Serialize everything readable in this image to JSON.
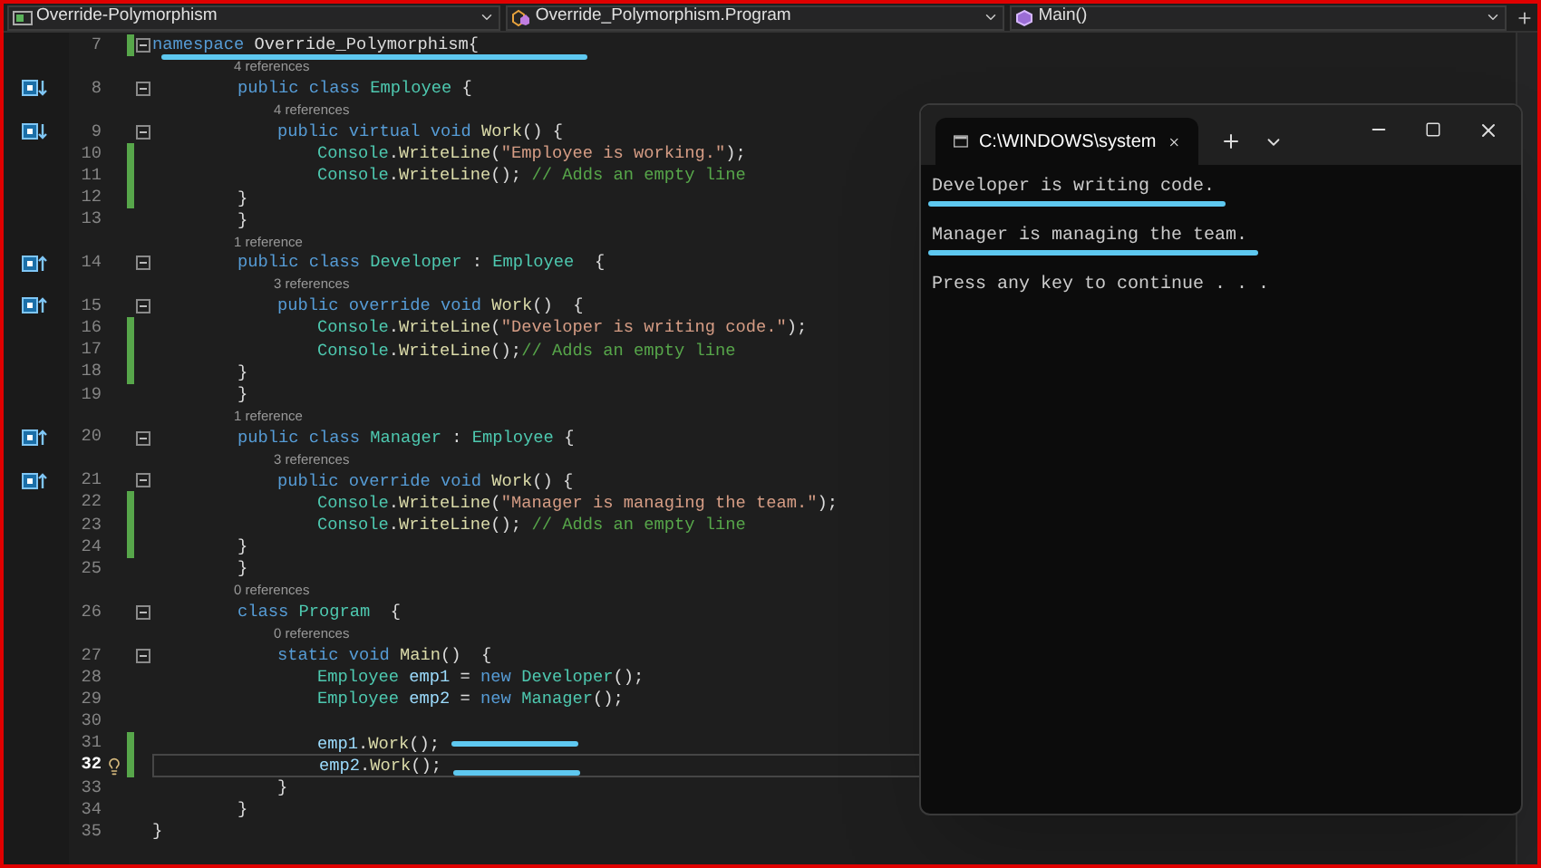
{
  "navigation_bar": {
    "project": "Override-Polymorphism",
    "type": "Override_Polymorphism.Program",
    "member": "Main()"
  },
  "editor": {
    "lines": [
      {
        "number": "7",
        "modified": true,
        "foldable": true,
        "current": false,
        "marked": true,
        "tokens": [
          {
            "kind": "kw",
            "text": "namespace "
          },
          {
            "kind": "plain",
            "text": "Override_Polymorphism{"
          }
        ],
        "children": [
          {
            "number": "8",
            "lens": "4 references",
            "gutter": {
              "kind": "overridden"
            },
            "modified": false,
            "foldable": true,
            "current": false,
            "marked": false,
            "tokens": [
              {
                "kind": "kw",
                "text": "public class "
              },
              {
                "kind": "type",
                "text": "Employee"
              },
              {
                "kind": "plain",
                "text": " {"
              }
            ],
            "children": [
              {
                "number": "9",
                "lens": "4 references",
                "gutter": {
                  "kind": "overridden"
                },
                "modified": false,
                "foldable": true,
                "current": false,
                "marked": false,
                "tokens": [
                  {
                    "kind": "kw",
                    "text": "public virtual void "
                  },
                  {
                    "kind": "method",
                    "text": "Work"
                  },
                  {
                    "kind": "plain",
                    "text": "() {"
                  }
                ],
                "children": [
                  {
                    "number": "10",
                    "modified": true,
                    "foldable": false,
                    "current": false,
                    "marked": false,
                    "tokens": [
                      {
                        "kind": "type",
                        "text": "Console"
                      },
                      {
                        "kind": "plain",
                        "text": "."
                      },
                      {
                        "kind": "method",
                        "text": "WriteLine"
                      },
                      {
                        "kind": "plain",
                        "text": "("
                      },
                      {
                        "kind": "str",
                        "text": "\"Employee is working.\""
                      },
                      {
                        "kind": "plain",
                        "text": ");"
                      }
                    ]
                  },
                  {
                    "number": "11",
                    "modified": true,
                    "foldable": false,
                    "current": false,
                    "marked": false,
                    "tokens": [
                      {
                        "kind": "type",
                        "text": "Console"
                      },
                      {
                        "kind": "plain",
                        "text": "."
                      },
                      {
                        "kind": "method",
                        "text": "WriteLine"
                      },
                      {
                        "kind": "plain",
                        "text": "(); "
                      },
                      {
                        "kind": "comment",
                        "text": "// Adds an empty line"
                      }
                    ]
                  }
                ]
              }
            ]
          },
          {
            "number": "12",
            "modified": true,
            "foldable": false,
            "current": false,
            "marked": false,
            "tokens": [
              {
                "kind": "plain",
                "text": "}"
              }
            ]
          },
          {
            "number": "13",
            "modified": false,
            "foldable": false,
            "current": false,
            "marked": false,
            "tokens": [
              {
                "kind": "plain",
                "text": "}"
              }
            ]
          },
          {
            "number": "14",
            "lens": "1 reference",
            "gutter": {
              "kind": "overrides"
            },
            "modified": false,
            "foldable": true,
            "current": false,
            "marked": false,
            "tokens": [
              {
                "kind": "kw",
                "text": "public class "
              },
              {
                "kind": "type",
                "text": "Developer"
              },
              {
                "kind": "plain",
                "text": " : "
              },
              {
                "kind": "type",
                "text": "Employee"
              },
              {
                "kind": "plain",
                "text": "  {"
              }
            ],
            "children": [
              {
                "number": "15",
                "lens": "3 references",
                "gutter": {
                  "kind": "overrides"
                },
                "modified": false,
                "foldable": true,
                "current": false,
                "marked": false,
                "tokens": [
                  {
                    "kind": "kw",
                    "text": "public override void "
                  },
                  {
                    "kind": "method",
                    "text": "Work"
                  },
                  {
                    "kind": "plain",
                    "text": "()  {"
                  }
                ],
                "children": [
                  {
                    "number": "16",
                    "modified": true,
                    "foldable": false,
                    "current": false,
                    "marked": false,
                    "tokens": [
                      {
                        "kind": "type",
                        "text": "Console"
                      },
                      {
                        "kind": "plain",
                        "text": "."
                      },
                      {
                        "kind": "method",
                        "text": "WriteLine"
                      },
                      {
                        "kind": "plain",
                        "text": "("
                      },
                      {
                        "kind": "str",
                        "text": "\"Developer is writing code.\""
                      },
                      {
                        "kind": "plain",
                        "text": ");"
                      }
                    ]
                  },
                  {
                    "number": "17",
                    "modified": true,
                    "foldable": false,
                    "current": false,
                    "marked": false,
                    "tokens": [
                      {
                        "kind": "type",
                        "text": "Console"
                      },
                      {
                        "kind": "plain",
                        "text": "."
                      },
                      {
                        "kind": "method",
                        "text": "WriteLine"
                      },
                      {
                        "kind": "plain",
                        "text": "();"
                      },
                      {
                        "kind": "comment",
                        "text": "// Adds an empty line"
                      }
                    ]
                  }
                ]
              }
            ]
          },
          {
            "number": "18",
            "modified": true,
            "foldable": false,
            "current": false,
            "marked": false,
            "tokens": [
              {
                "kind": "plain",
                "text": "}"
              }
            ]
          },
          {
            "number": "19",
            "modified": false,
            "foldable": false,
            "current": false,
            "marked": false,
            "tokens": [
              {
                "kind": "plain",
                "text": "}"
              }
            ]
          },
          {
            "number": "20",
            "lens": "1 reference",
            "gutter": {
              "kind": "overrides"
            },
            "modified": false,
            "foldable": true,
            "current": false,
            "marked": false,
            "tokens": [
              {
                "kind": "kw",
                "text": "public class "
              },
              {
                "kind": "type",
                "text": "Manager"
              },
              {
                "kind": "plain",
                "text": " : "
              },
              {
                "kind": "type",
                "text": "Employee"
              },
              {
                "kind": "plain",
                "text": " {"
              }
            ],
            "children": [
              {
                "number": "21",
                "lens": "3 references",
                "gutter": {
                  "kind": "overrides"
                },
                "modified": false,
                "foldable": true,
                "current": false,
                "marked": false,
                "tokens": [
                  {
                    "kind": "kw",
                    "text": "public override void "
                  },
                  {
                    "kind": "method",
                    "text": "Work"
                  },
                  {
                    "kind": "plain",
                    "text": "() {"
                  }
                ],
                "children": [
                  {
                    "number": "22",
                    "modified": true,
                    "foldable": false,
                    "current": false,
                    "marked": false,
                    "tokens": [
                      {
                        "kind": "type",
                        "text": "Console"
                      },
                      {
                        "kind": "plain",
                        "text": "."
                      },
                      {
                        "kind": "method",
                        "text": "WriteLine"
                      },
                      {
                        "kind": "plain",
                        "text": "("
                      },
                      {
                        "kind": "str",
                        "text": "\"Manager is managing the team.\""
                      },
                      {
                        "kind": "plain",
                        "text": ");"
                      }
                    ]
                  },
                  {
                    "number": "23",
                    "modified": true,
                    "foldable": false,
                    "current": false,
                    "marked": false,
                    "tokens": [
                      {
                        "kind": "type",
                        "text": "Console"
                      },
                      {
                        "kind": "plain",
                        "text": "."
                      },
                      {
                        "kind": "method",
                        "text": "WriteLine"
                      },
                      {
                        "kind": "plain",
                        "text": "(); "
                      },
                      {
                        "kind": "comment",
                        "text": "// Adds an empty line"
                      }
                    ]
                  }
                ]
              }
            ]
          },
          {
            "number": "24",
            "modified": true,
            "foldable": false,
            "current": false,
            "marked": false,
            "tokens": [
              {
                "kind": "plain",
                "text": "}"
              }
            ]
          },
          {
            "number": "25",
            "modified": false,
            "foldable": false,
            "current": false,
            "marked": false,
            "tokens": [
              {
                "kind": "plain",
                "text": "}"
              }
            ]
          },
          {
            "number": "26",
            "lens": "0 references",
            "modified": false,
            "foldable": true,
            "current": false,
            "marked": false,
            "tokens": [
              {
                "kind": "kw",
                "text": "class "
              },
              {
                "kind": "type",
                "text": "Program"
              },
              {
                "kind": "plain",
                "text": "  {"
              }
            ],
            "children": [
              {
                "number": "27",
                "lens": "0 references",
                "modified": false,
                "foldable": true,
                "current": false,
                "marked": false,
                "tokens": [
                  {
                    "kind": "kw",
                    "text": "static void "
                  },
                  {
                    "kind": "method",
                    "text": "Main"
                  },
                  {
                    "kind": "plain",
                    "text": "()  {"
                  }
                ],
                "children": [
                  {
                    "number": "28",
                    "modified": false,
                    "foldable": false,
                    "current": false,
                    "marked": false,
                    "tokens": [
                      {
                        "kind": "type",
                        "text": "Employee "
                      },
                      {
                        "kind": "var",
                        "text": "emp1"
                      },
                      {
                        "kind": "plain",
                        "text": " = "
                      },
                      {
                        "kind": "kw",
                        "text": "new "
                      },
                      {
                        "kind": "type",
                        "text": "Developer"
                      },
                      {
                        "kind": "plain",
                        "text": "();"
                      }
                    ]
                  },
                  {
                    "number": "29",
                    "modified": false,
                    "foldable": false,
                    "current": false,
                    "marked": false,
                    "tokens": [
                      {
                        "kind": "type",
                        "text": "Employee "
                      },
                      {
                        "kind": "var",
                        "text": "emp2"
                      },
                      {
                        "kind": "plain",
                        "text": " = "
                      },
                      {
                        "kind": "kw",
                        "text": "new "
                      },
                      {
                        "kind": "type",
                        "text": "Manager"
                      },
                      {
                        "kind": "plain",
                        "text": "();"
                      }
                    ]
                  },
                  {
                    "number": "30",
                    "modified": false,
                    "foldable": false,
                    "current": false,
                    "marked": false
                  },
                  {
                    "number": "31",
                    "modified": true,
                    "foldable": false,
                    "current": false,
                    "marked": true,
                    "tokens": [
                      {
                        "kind": "var",
                        "text": "emp1"
                      },
                      {
                        "kind": "plain",
                        "text": "."
                      },
                      {
                        "kind": "method",
                        "text": "Work"
                      },
                      {
                        "kind": "plain",
                        "text": "();"
                      }
                    ]
                  },
                  {
                    "number": "32",
                    "gutter": {
                      "kind": "lightbulb"
                    },
                    "modified": true,
                    "foldable": false,
                    "current": true,
                    "marked": true,
                    "tokens": [
                      {
                        "kind": "var",
                        "text": "emp2"
                      },
                      {
                        "kind": "plain",
                        "text": "."
                      },
                      {
                        "kind": "method",
                        "text": "Work"
                      },
                      {
                        "kind": "plain",
                        "text": "();"
                      }
                    ]
                  }
                ]
              },
              {
                "number": "33",
                "modified": false,
                "foldable": false,
                "current": false,
                "marked": false,
                "tokens": [
                  {
                    "kind": "plain",
                    "text": "}"
                  }
                ]
              }
            ]
          },
          {
            "number": "34",
            "modified": false,
            "foldable": false,
            "current": false,
            "marked": false,
            "tokens": [
              {
                "kind": "plain",
                "text": "}"
              }
            ]
          }
        ]
      },
      {
        "number": "35",
        "modified": false,
        "foldable": false,
        "current": false,
        "marked": false,
        "tokens": [
          {
            "kind": "plain",
            "text": "}"
          }
        ]
      }
    ]
  },
  "console": {
    "title": "C:\\WINDOWS\\system",
    "lines": [
      {
        "text": "Developer is writing code.",
        "marked": true
      },
      {
        "text": "Manager is managing the team.",
        "marked": true
      },
      {
        "text": "Press any key to continue . . .",
        "marked": false
      }
    ]
  }
}
